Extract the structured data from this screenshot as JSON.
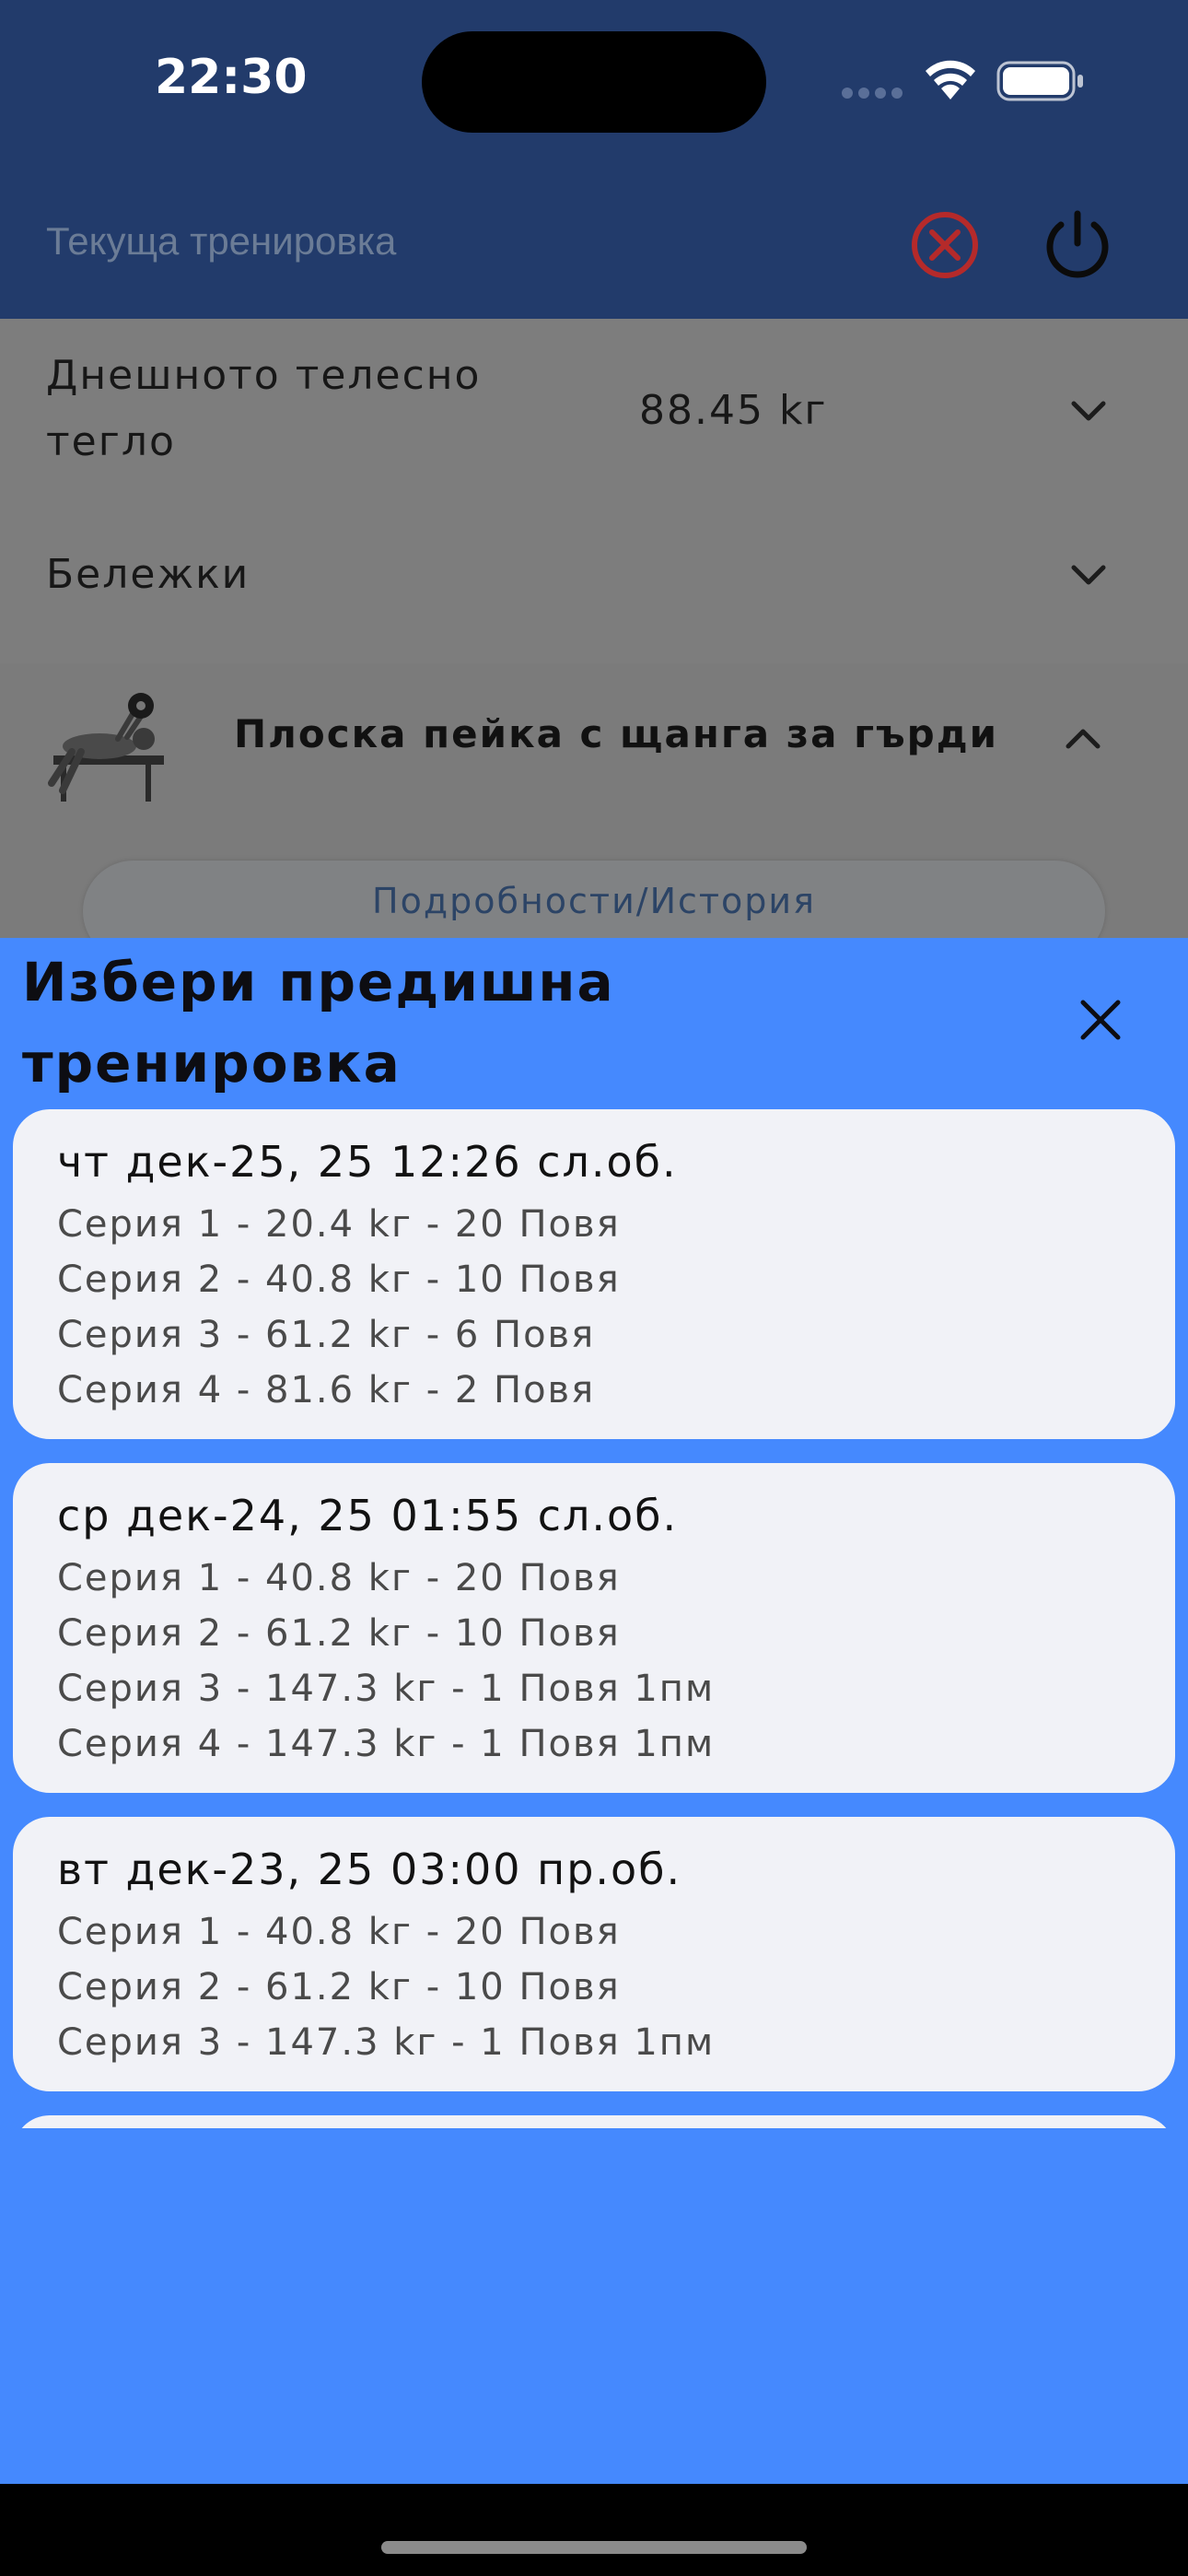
{
  "status_bar": {
    "time": "22:30"
  },
  "appbar": {
    "title": "Текуща тренировка",
    "cancel_icon": "cancel-circle-icon",
    "power_icon": "power-icon"
  },
  "body_weight": {
    "label": "Днешното телесно тегло",
    "label_line1": "Днешното телесно",
    "label_line2": "тегло",
    "value": "88.45 kг"
  },
  "notes": {
    "label": "Бележки"
  },
  "exercise": {
    "name": "Плоска пейка с щанга за гърди",
    "details_label": "Подробности/История"
  },
  "sheet": {
    "title_line1": "Избери предишна",
    "title_line2": "тренировка",
    "workouts": [
      {
        "date": "чт дек-25, 25 12:26 сл.об.",
        "sets": [
          "Серия 1 - 20.4 kг - 20 Повя",
          "Серия 2 - 40.8 kг - 10 Повя",
          "Серия 3 - 61.2 kг - 6 Повя",
          "Серия 4 - 81.6 kг - 2 Повя"
        ]
      },
      {
        "date": "ср дек-24, 25 01:55 сл.об.",
        "sets": [
          "Серия 1 - 40.8 kг - 20 Повя",
          "Серия 2 - 61.2 kг - 10 Повя",
          "Серия 3 - 147.3 kг - 1 Повя 1пм",
          "Серия 4 - 147.3 kг - 1 Повя 1пм"
        ]
      },
      {
        "date": "вт дек-23, 25 03:00 пр.об.",
        "sets": [
          "Серия 1 - 40.8 kг - 20 Повя",
          "Серия 2 - 61.2 kг - 10 Повя",
          "Серия 3 - 147.3 kг - 1 Повя 1пм"
        ]
      }
    ]
  },
  "colors": {
    "sheet_bg": "#4589fe",
    "appbar_bg": "#223b6b",
    "cancel_red": "#b52a2a",
    "card_bg": "#f1f2f7"
  }
}
